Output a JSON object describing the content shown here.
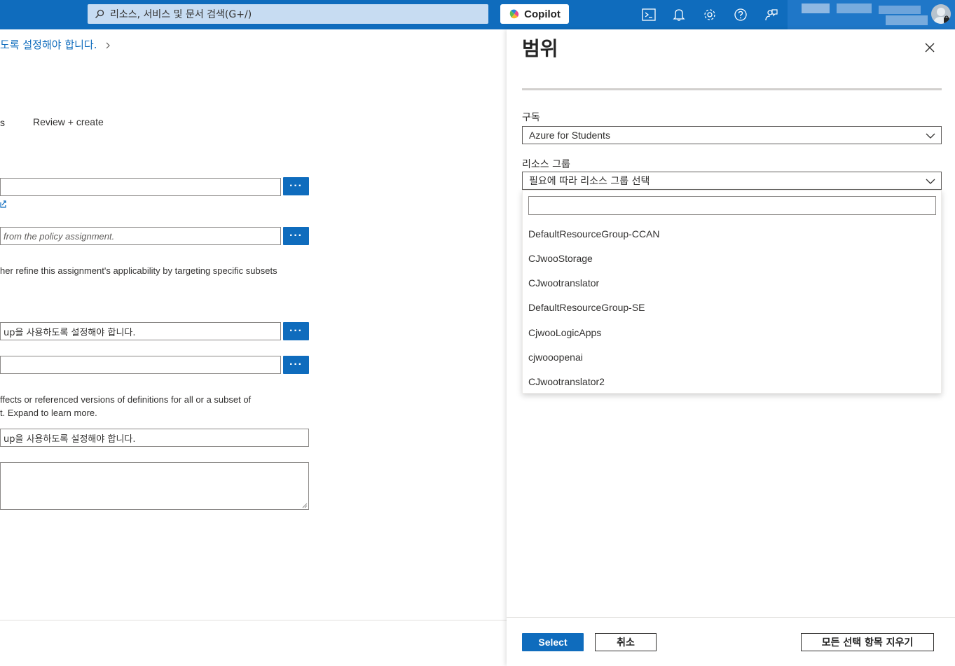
{
  "topbar": {
    "search_placeholder": "리소스, 서비스 및 문서 검색(G+/)",
    "copilot_label": "Copilot",
    "icons": [
      "cloud-shell-icon",
      "bell-icon",
      "gear-icon",
      "help-icon",
      "feedback-icon"
    ]
  },
  "background": {
    "breadcrumb": "도록 설정해야 합니다.",
    "tab_fragment": "s",
    "tab_review": "Review + create",
    "field_overrides_placeholder": "from the policy assignment.",
    "refine_text": "her refine this assignment's applicability by targeting specific subsets",
    "field_assignment_name": "up을 사용하도록 설정해야 합니다.",
    "overrides_text_1": "ffects or referenced versions of definitions for all or a subset of",
    "overrides_text_2": "t. Expand to learn more.",
    "field_display_name": "up을 사용하도록 설정해야 합니다."
  },
  "panel": {
    "title": "범위",
    "subscription_label": "구독",
    "subscription_value": "Azure for Students",
    "resource_group_label": "리소스 그룹",
    "resource_group_placeholder": "필요에 따라 리소스 그룹 선택",
    "resource_groups": [
      "DefaultResourceGroup-CCAN",
      "CJwooStorage",
      "CJwootranslator",
      "DefaultResourceGroup-SE",
      "CjwooLogicApps",
      "cjwooopenai",
      "CJwootranslator2"
    ],
    "select_button": "Select",
    "cancel_button": "취소",
    "clear_button": "모든 선택 항목 지우기"
  },
  "colors": {
    "brand": "#0f6cbd",
    "link": "#0f6cbd"
  }
}
